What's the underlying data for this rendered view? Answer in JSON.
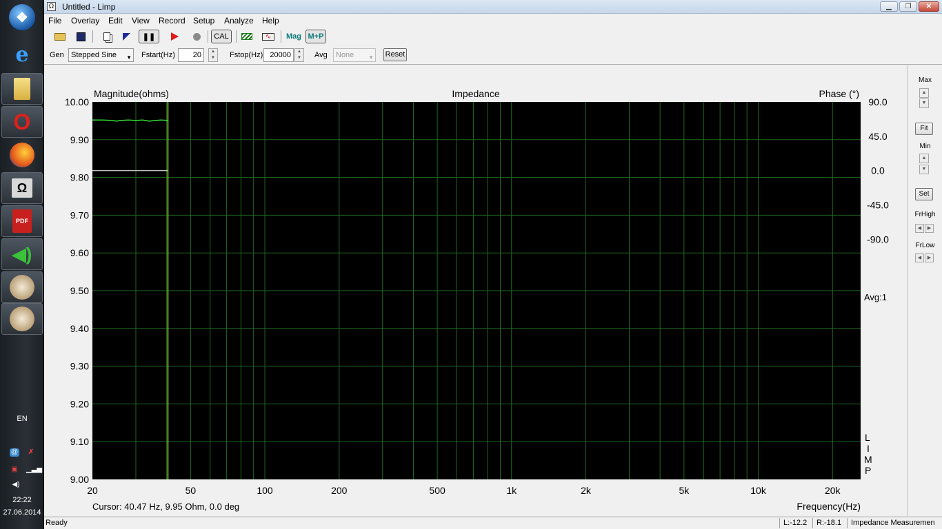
{
  "taskbar": {
    "icons": [
      "windows-start",
      "internet-explorer",
      "file-explorer",
      "opera",
      "firefox",
      "omega-app",
      "pdf-reader",
      "speaker-app",
      "paint-app",
      "paint-app"
    ],
    "language": "EN",
    "time": "22:22",
    "date": "27.06.2014"
  },
  "window": {
    "title": "Untitled - Limp",
    "icon_glyph": "Ω"
  },
  "menu": [
    "File",
    "Overlay",
    "Edit",
    "View",
    "Record",
    "Setup",
    "Analyze",
    "Help"
  ],
  "toolbar": {
    "cal_label": "CAL",
    "mag_label": "Mag",
    "mp_label": "M+P"
  },
  "generator": {
    "gen_label": "Gen",
    "gen_value": "Stepped Sine",
    "fstart_label": "Fstart(Hz)",
    "fstart_value": "20",
    "fstop_label": "Fstop(Hz)",
    "fstop_value": "20000",
    "avg_label": "Avg",
    "avg_value": "None",
    "reset_label": "Reset"
  },
  "right_panel": {
    "max_label": "Max",
    "fit_label": "Fit",
    "min_label": "Min",
    "set_label": "Set",
    "frhigh_label": "FrHigh",
    "frlow_label": "FrLow"
  },
  "graph": {
    "avg_text": "Avg:1",
    "brand_letters": [
      "L",
      "I",
      "M",
      "P"
    ],
    "cursor_text": "Cursor: 40.47 Hz, 9.95 Ohm, 0.0 deg"
  },
  "status": {
    "ready": "Ready",
    "left_level": "L:-12.2",
    "right_level": "R:-18.1",
    "mode": "Impedance Measuremen"
  },
  "chart_data": {
    "type": "line",
    "title": "Impedance",
    "ylabel": "Magnitude(ohms)",
    "y2label": "Phase (°)",
    "xlabel": "Frequency(Hz)",
    "x_scale": "log",
    "xlim": [
      20,
      26000
    ],
    "ylim": [
      9.0,
      10.0
    ],
    "y2lim": [
      -405,
      90
    ],
    "x_ticks": [
      20,
      50,
      100,
      200,
      500,
      1000,
      2000,
      5000,
      10000,
      20000
    ],
    "x_tick_labels": [
      "20",
      "50",
      "100",
      "200",
      "500",
      "1k",
      "2k",
      "5k",
      "10k",
      "20k"
    ],
    "y_ticks": [
      "10.00",
      "9.90",
      "9.80",
      "9.70",
      "9.60",
      "9.50",
      "9.40",
      "9.30",
      "9.20",
      "9.10",
      "9.00"
    ],
    "y2_ticks": [
      "90.0",
      "45.0",
      "0.0",
      "-45.0",
      "-90.0"
    ],
    "y2_tick_values": [
      90,
      45,
      0,
      -45,
      -90
    ],
    "grid": true,
    "background": "#000000",
    "grid_color": "#1f6b1f",
    "cursor_x": 40.47,
    "cursor_color": "#9acd32",
    "series": [
      {
        "axis": "left",
        "color": "#33dd33",
        "x": [
          20,
          22,
          24,
          25,
          26,
          28,
          30,
          32,
          34,
          36,
          38,
          40.47
        ],
        "y": [
          9.952,
          9.952,
          9.951,
          9.949,
          9.951,
          9.952,
          9.951,
          9.952,
          9.949,
          9.951,
          9.952,
          9.951
        ]
      },
      {
        "axis": "right",
        "color": "#c0c0c0",
        "x": [
          20,
          40.47
        ],
        "y": [
          0.0,
          0.0
        ]
      }
    ]
  }
}
